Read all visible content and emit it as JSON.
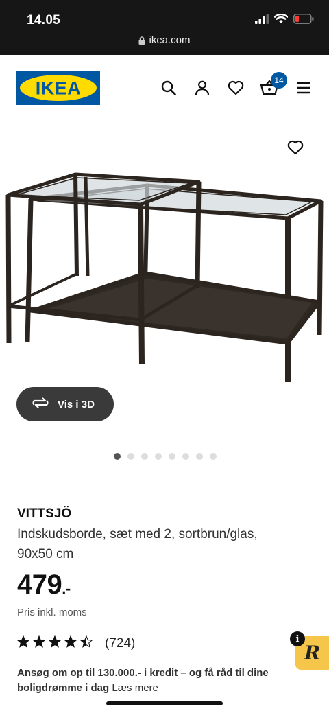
{
  "status_bar": {
    "time": "14.05",
    "url": "ikea.com",
    "icons": [
      "signal-icon",
      "wifi-icon",
      "battery-low-icon"
    ]
  },
  "header": {
    "logo_text": "IKEA",
    "icons": [
      "search-icon",
      "account-icon",
      "wishlist-icon",
      "cart-icon",
      "menu-icon"
    ],
    "cart_count": "14"
  },
  "product": {
    "view_3d_label": "Vis i 3D",
    "image_count": 8,
    "active_image": 0,
    "brand": "VITTSJÖ",
    "description": "Indskudsborde, sæt med 2, sortbrun/glas,",
    "size": "90x50 cm",
    "price": "479",
    "price_suffix": ".-",
    "vat_note": "Pris inkl. moms",
    "rating_stars": 4.5,
    "rating_count": "(724)"
  },
  "credit": {
    "text": "Ansøg om op til 130.000.- i kredit – og få råd til dine boligdrømme i dag",
    "link": "Læs mere"
  },
  "widget": {
    "info_label": "i",
    "badge_letter": "R"
  },
  "colors": {
    "ikea_blue": "#0058A3",
    "ikea_yellow": "#FFDB00",
    "status_bar": "#161616",
    "view3d_bg": "#3a3a3a",
    "widget_yellow": "#F6C64A"
  }
}
